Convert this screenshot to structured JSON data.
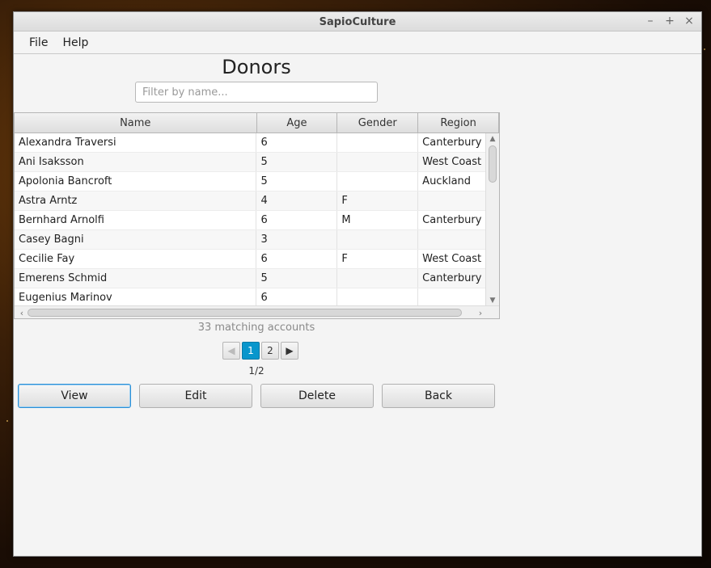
{
  "window": {
    "title": "SapioCulture",
    "controls": [
      "–",
      "+",
      "×"
    ]
  },
  "menu": {
    "items": [
      "File",
      "Help"
    ]
  },
  "main": {
    "heading": "Donors",
    "filter_placeholder": "Filter by name...",
    "filter_value": ""
  },
  "table": {
    "columns": [
      "Name",
      "Age",
      "Gender",
      "Region"
    ],
    "rows": [
      {
        "name": "Alexandra Traversi",
        "age": "6",
        "gender": "",
        "region": "Canterbury"
      },
      {
        "name": "Ani Isaksson",
        "age": "5",
        "gender": "",
        "region": "West Coast"
      },
      {
        "name": "Apolonia Bancroft",
        "age": "5",
        "gender": "",
        "region": "Auckland"
      },
      {
        "name": "Astra Arntz",
        "age": "4",
        "gender": "F",
        "region": ""
      },
      {
        "name": "Bernhard Arnolfi",
        "age": "6",
        "gender": "M",
        "region": "Canterbury"
      },
      {
        "name": "Casey Bagni",
        "age": "3",
        "gender": "",
        "region": ""
      },
      {
        "name": "Cecilie Fay",
        "age": "6",
        "gender": "F",
        "region": "West Coast"
      },
      {
        "name": "Emerens Schmid",
        "age": "5",
        "gender": "",
        "region": "Canterbury"
      },
      {
        "name": "Eugenius Marinov",
        "age": "6",
        "gender": "",
        "region": ""
      }
    ]
  },
  "status": {
    "count_text": "33 matching accounts"
  },
  "pagination": {
    "prev": "◀",
    "next": "▶",
    "pages": [
      "1",
      "2"
    ],
    "current": "1",
    "label": "1/2"
  },
  "actions": {
    "view": "View",
    "edit": "Edit",
    "delete": "Delete",
    "back": "Back"
  },
  "colors": {
    "accent": "#0896cc",
    "focus": "#2a8fd6"
  }
}
